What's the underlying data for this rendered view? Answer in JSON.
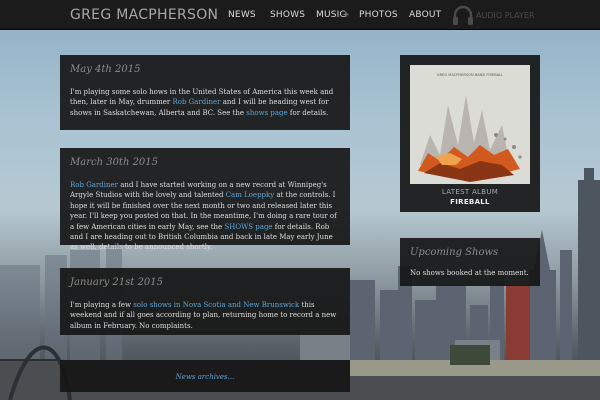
{
  "site": {
    "title": "GREG MACPHERSON"
  },
  "nav": {
    "items": [
      "NEWS",
      "SHOWS",
      "MUSIC",
      "PHOTOS",
      "ABOUT"
    ],
    "audio_player": "AUDIO PLAYER",
    "audio_icon": "headphones-icon"
  },
  "posts": [
    {
      "date": "May 4th 2015",
      "parts": [
        "I'm playing some solo hows in the United States of America this week and then, later in May, drummer ",
        {
          "link": "Rob Gardiner"
        },
        " and I will be heading west for shows in Saskatchewan, Alberta and BC. See the ",
        {
          "link": "shows page"
        },
        " for details."
      ]
    },
    {
      "date": "March 30th 2015",
      "parts": [
        {
          "link": "Rob Gardiner"
        },
        " and I have started working on a new record at Winnipeg's Argyle Studios with the lovely and talented ",
        {
          "link": "Cam Loeppky"
        },
        " at the controls. I hope it will be finished over the next month or two and released later this year. I'll keep you posted on that. In the meantime, I'm doing a rare tour of a few American cities in early May, see the ",
        {
          "link": "SHOWS page"
        },
        " for details. Rob and I are heading out to British Columbia and back in late May early June as well, details to be announced shortly."
      ]
    },
    {
      "date": "January 21st 2015",
      "parts": [
        "I'm playing a few ",
        {
          "link": "solo shows in Nova Scotia and New Brunswick"
        },
        " this weekend and if all goes according to plan, returning home to record a new album in February. No complaints."
      ]
    }
  ],
  "archives_link": "News archives...",
  "album": {
    "cover_text": "GREG MACPHERSON BAND FIREBALL",
    "caption": "LATEST ALBUM",
    "name": "FIREBALL"
  },
  "upcoming": {
    "title": "Upcoming Shows",
    "text": "No shows booked at the moment."
  },
  "colors": {
    "nav_bg": "#1b1b1b",
    "panel_bg": "#161616",
    "link": "#5ea6d6",
    "title_grey": "#8c8c8c"
  }
}
